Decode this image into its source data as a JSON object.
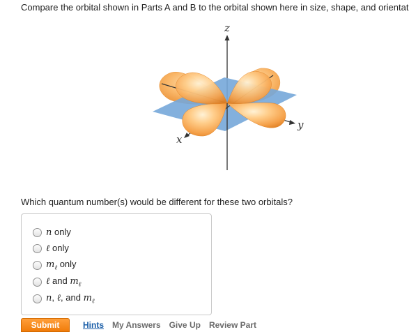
{
  "prompt": "Compare the orbital shown in Parts A and B to the orbital shown here in size, shape, and orientat",
  "diagram": {
    "axis_z": "z",
    "axis_y": "y",
    "axis_x": "x"
  },
  "question": "Which quantum number(s) would be different for these two orbitals?",
  "choices": [
    {
      "pre": "",
      "var1": "n",
      "mid": "",
      "var2": "",
      "sub": "",
      "post": " only"
    },
    {
      "pre": "",
      "var1": "ℓ",
      "mid": "",
      "var2": "",
      "sub": "",
      "post": " only"
    },
    {
      "pre": "",
      "var1": "m",
      "mid": "",
      "var2": "",
      "sub": "ℓ",
      "post": " only"
    },
    {
      "pre": "",
      "var1": "ℓ",
      "mid": " and ",
      "var2": "m",
      "sub": "ℓ",
      "post": ""
    },
    {
      "pre": "",
      "var1": "n",
      "mid": ", ",
      "var2": "ℓ",
      "sub": "",
      "post": ", and ",
      "var3": "m",
      "sub3": "ℓ"
    }
  ],
  "toolbar": {
    "submit": "Submit",
    "hints": "Hints",
    "my_answers": "My Answers",
    "give_up": "Give Up",
    "review_part": "Review Part"
  }
}
